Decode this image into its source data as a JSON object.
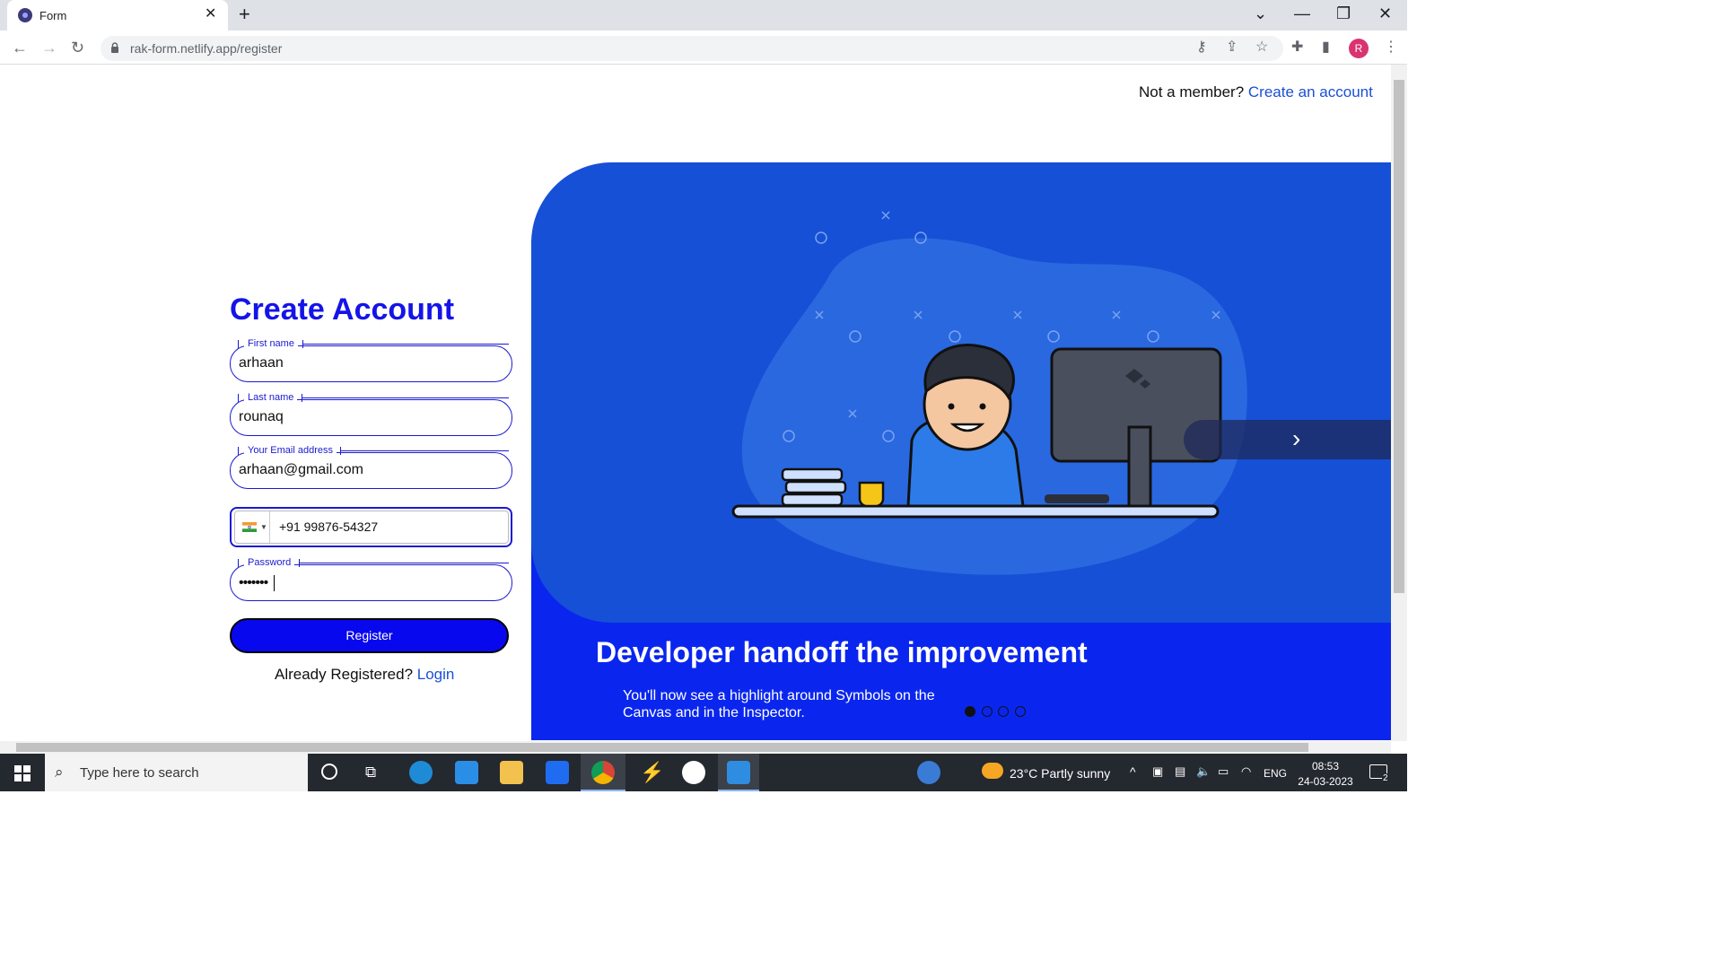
{
  "browser": {
    "tab_title": "Form",
    "tab_close": "✕",
    "new_tab": "+",
    "url": "rak-form.netlify.app/register",
    "profile_initial": "R",
    "window_controls": {
      "minimize": "—",
      "restore": "❐",
      "close": "✕",
      "tab_search": "⌄"
    },
    "nav": {
      "back": "←",
      "forward": "→",
      "reload": "↻"
    },
    "toolbar_icons": {
      "key": "⚷",
      "share": "⇪",
      "star": "☆",
      "extensions": "✚",
      "sidepanel": "▮",
      "menu": "⋮"
    }
  },
  "header": {
    "prompt": "Not a member?",
    "link": "Create an account"
  },
  "form": {
    "title": "Create Account",
    "first_name": {
      "label": "First name",
      "value": "arhaan"
    },
    "last_name": {
      "label": "Last name",
      "value": "rounaq"
    },
    "email": {
      "label": "Your Email address",
      "value": "arhaan@gmail.com"
    },
    "phone": {
      "value": "+91 99876-54327",
      "country_icon": "india-flag-icon"
    },
    "password": {
      "label": "Password",
      "value": "•••••••"
    },
    "register_label": "Register",
    "login_prompt": "Already Registered?",
    "login_link": "Login"
  },
  "carousel": {
    "title": "Developer handoff the improvement",
    "description": "You'll now see a highlight around Symbols on the Canvas and in the Inspector.",
    "next_icon": "›",
    "slide_count": 4,
    "active_index": 0
  },
  "taskbar": {
    "search_placeholder": "Type here to search",
    "weather": "23°C  Partly sunny",
    "language": "ENG",
    "time": "08:53",
    "date": "24-03-2023",
    "notification_count": "2"
  },
  "colors": {
    "accent": "#1414e8",
    "carousel_bg": "#0a26ee",
    "slide_bg": "#1650d6",
    "link": "#1a4fd6"
  }
}
